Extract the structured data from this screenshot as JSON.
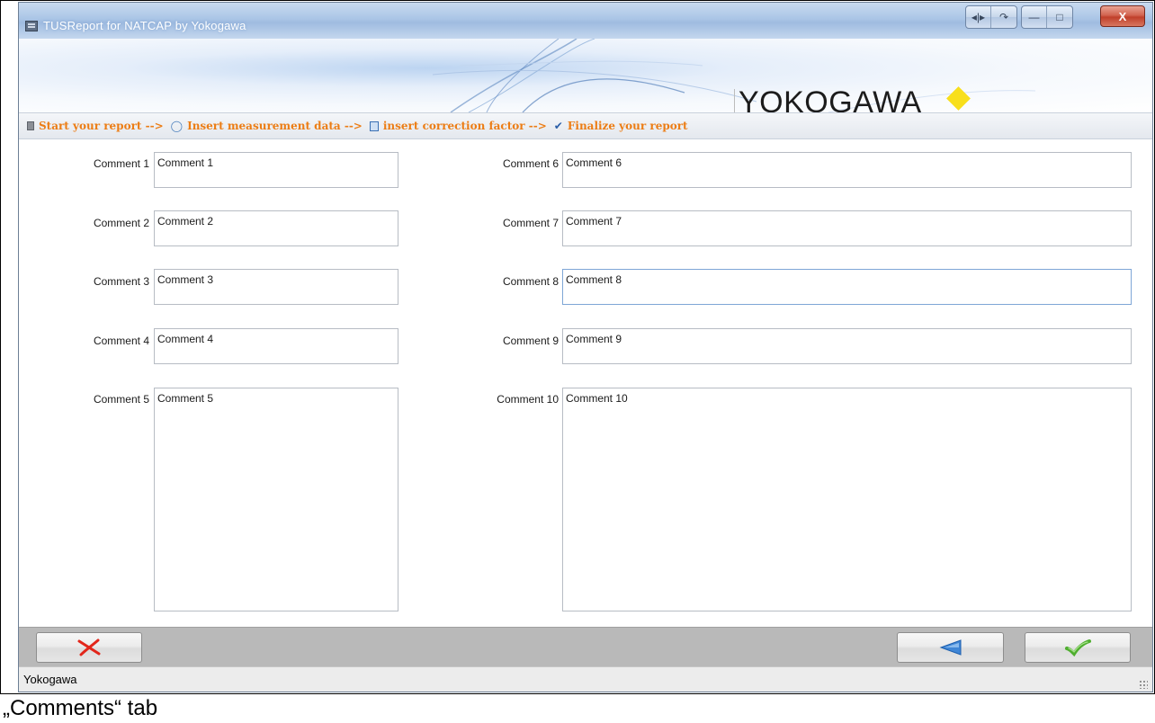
{
  "window": {
    "title": "TUSReport for NATCAP by Yokogawa"
  },
  "banner": {
    "logo_text": "YOKOGAWA",
    "logo_accent_color": "#f8df1c"
  },
  "steps": [
    {
      "label": "Start your report -->",
      "icon": "document-icon"
    },
    {
      "label": "Insert measurement data -->",
      "icon": "measurement-icon"
    },
    {
      "label": "insert correction factor -->",
      "icon": "correction-icon"
    },
    {
      "label": "Finalize your report",
      "icon": "checkmark-icon"
    }
  ],
  "steps_color": "#ec7d15",
  "comments": [
    {
      "label": "Comment 1",
      "value": "Comment 1"
    },
    {
      "label": "Comment 2",
      "value": "Comment 2"
    },
    {
      "label": "Comment 3",
      "value": "Comment 3"
    },
    {
      "label": "Comment 4",
      "value": "Comment 4"
    },
    {
      "label": "Comment 5",
      "value": "Comment 5"
    },
    {
      "label": "Comment 6",
      "value": "Comment 6"
    },
    {
      "label": "Comment 7",
      "value": "Comment 7"
    },
    {
      "label": "Comment 8",
      "value": "Comment 8"
    },
    {
      "label": "Comment 9",
      "value": "Comment 9"
    },
    {
      "label": "Comment 10",
      "value": "Comment 10"
    }
  ],
  "buttons": {
    "cancel_icon": "red-x-icon",
    "back_icon": "blue-arrow-left-icon",
    "finish_icon": "green-check-icon"
  },
  "status": {
    "text": "Yokogawa"
  },
  "caption": "„Comments“ tab"
}
